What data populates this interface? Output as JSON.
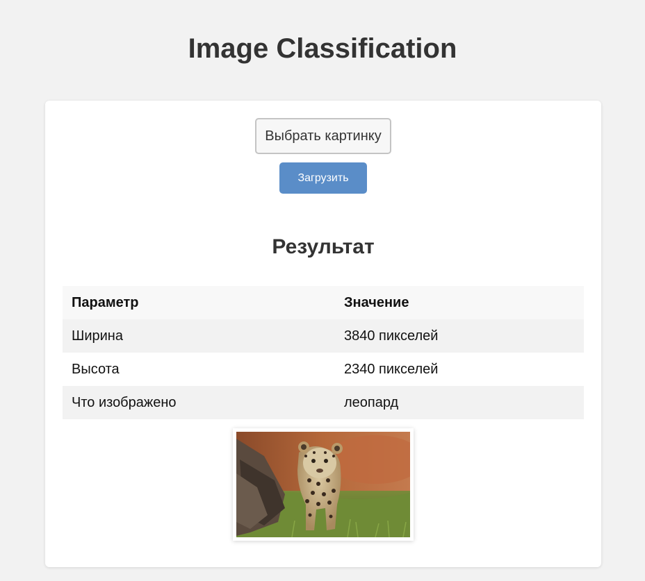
{
  "page": {
    "title": "Image Classification"
  },
  "upload": {
    "choose_label": "Выбрать картинку",
    "upload_label": "Загрузить"
  },
  "result": {
    "title": "Результат",
    "headers": [
      "Параметр",
      "Значение"
    ],
    "rows": [
      {
        "param": "Ширина",
        "value": "3840 пикселей"
      },
      {
        "param": "Высота",
        "value": "2340 пикселей"
      },
      {
        "param": "Что изображено",
        "value": "леопард"
      }
    ]
  },
  "colors": {
    "background": "#f2f2f2",
    "card": "#ffffff",
    "upload_button": "#5a8dc8",
    "text": "#333333"
  },
  "image": {
    "subject_icon": "leopard-cub-photo"
  }
}
